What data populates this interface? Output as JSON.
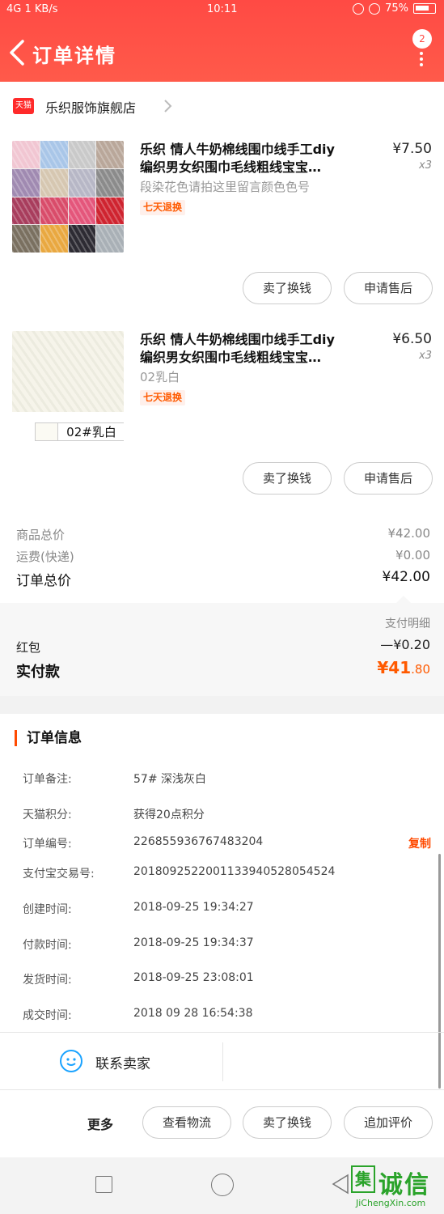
{
  "status_bar": {
    "signal": "4G",
    "speed": "1 KB/s",
    "time": "10:11",
    "battery": "75%"
  },
  "header": {
    "title": "订单详情",
    "badge": "2"
  },
  "store": {
    "badge": "天猫",
    "name": "乐织服饰旗舰店"
  },
  "products": [
    {
      "name_line1": "乐织 情人牛奶棉线围巾线手工diy",
      "name_line2": "编织男女织围巾毛线粗线宝宝…",
      "price": "¥7.50",
      "qty": "x3",
      "sku": "段染花色请拍这里留言颜色色号",
      "tag": "七天退换",
      "btn_return": "卖了换钱",
      "btn_after": "申请售后",
      "swatch_colors": [
        "#f1c6d2",
        "#a9c6e8",
        "#c9c9c9",
        "#b9a79a",
        "#a08ab1",
        "#d6c7b1",
        "#b7b7c6",
        "#8b8b8b",
        "#a83d5d",
        "#d94c6a",
        "#e4567b",
        "#cf2430",
        "#7a7060",
        "#e9a840",
        "#2d2b33",
        "#a9b0b6"
      ]
    },
    {
      "name_line1": "乐织 情人牛奶棉线围巾线手工diy",
      "name_line2": "编织男女织围巾毛线粗线宝宝…",
      "price": "¥6.50",
      "qty": "x3",
      "sku": "02乳白",
      "image_label": "02#乳白",
      "tag": "七天退换",
      "btn_return": "卖了换钱",
      "btn_after": "申请售后"
    }
  ],
  "summary": {
    "goods_label": "商品总价",
    "goods_value": "¥42.00",
    "shipping_label": "运费(快递)",
    "shipping_value": "¥0.00",
    "total_label": "订单总价",
    "total_value": "¥42.00",
    "detail_link": "支付明细",
    "redpack_label": "红包",
    "redpack_value": "—¥0.20",
    "paid_label": "实付款",
    "paid_value_main": "¥41",
    "paid_value_cents": ".80"
  },
  "order_info": {
    "title": "订单信息",
    "rows": [
      {
        "k": "订单备注:",
        "v": "57# 深浅灰白"
      },
      {
        "k": "天猫积分:",
        "v": "获得20点积分"
      },
      {
        "k": "订单编号:",
        "v": "226855936767483204"
      },
      {
        "k": "支付宝交易号:",
        "v": "2018092522001133940528054524"
      },
      {
        "k": "创建时间:",
        "v": "2018-09-25 19:34:27"
      },
      {
        "k": "付款时间:",
        "v": "2018-09-25 19:34:37"
      },
      {
        "k": "发货时间:",
        "v": "2018-09-25 23:08:01"
      },
      {
        "k": "成交时间:",
        "v": "2018 09 28 16:54:38"
      }
    ],
    "copy_label": "复制"
  },
  "contact": {
    "label": "联系卖家"
  },
  "bottom": {
    "more": "更多",
    "btn_logistics": "查看物流",
    "btn_return": "卖了换钱",
    "btn_review": "追加评价"
  },
  "watermark": {
    "box": "集",
    "text": "诚信",
    "sub": "JiChengXin.com"
  },
  "colors": {
    "accent": "#ff4a44",
    "orange": "#ff4a00"
  }
}
